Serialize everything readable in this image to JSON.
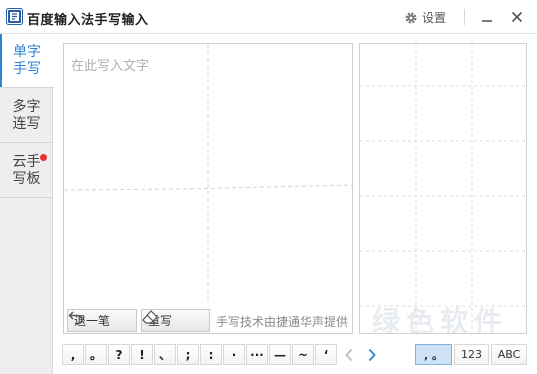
{
  "app": {
    "title": "百度输入法手写输入",
    "settings_label": "设置"
  },
  "sidebar": {
    "tabs": [
      {
        "label": "单字手写",
        "active": true,
        "badge": false
      },
      {
        "label": "多字连写",
        "active": false,
        "badge": false
      },
      {
        "label": "云手写板",
        "active": false,
        "badge": true
      }
    ]
  },
  "canvas": {
    "placeholder": "在此写入文字",
    "undo_label": "退一笔",
    "rewrite_label": "重写",
    "credit": "手写技术由捷通华声提供"
  },
  "punctuation": [
    ",",
    "。",
    "?",
    "!",
    "、",
    ";",
    ":",
    "·",
    "···",
    "—",
    "~",
    "‘"
  ],
  "modes": [
    {
      "label": ", 。",
      "active": true
    },
    {
      "label": "123",
      "active": false
    },
    {
      "label": "ABC",
      "active": false
    }
  ],
  "watermark": "绿色软件",
  "colors": {
    "accent": "#2e84d4",
    "badge": "#e9302f"
  }
}
